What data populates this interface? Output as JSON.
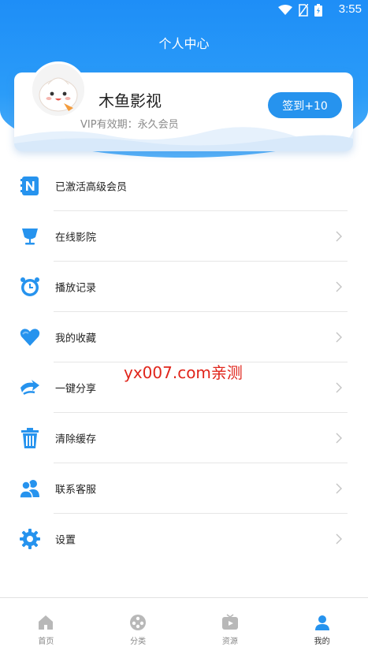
{
  "status_bar": {
    "time": "3:55"
  },
  "header": {
    "title": "个人中心"
  },
  "profile": {
    "name": "木鱼影视",
    "vip": "VIP有效期：永久会员",
    "signin_label": "签到+10"
  },
  "menu": {
    "items": [
      {
        "label": "已激活高级会员",
        "icon": "n-badge-icon",
        "chevron": false
      },
      {
        "label": "在线影院",
        "icon": "cinema-cup-icon",
        "chevron": true
      },
      {
        "label": "播放记录",
        "icon": "alarm-clock-icon",
        "chevron": true
      },
      {
        "label": "我的收藏",
        "icon": "heart-icon",
        "chevron": true
      },
      {
        "label": "一键分享",
        "icon": "share-icon",
        "chevron": true
      },
      {
        "label": "清除缓存",
        "icon": "trash-icon",
        "chevron": true
      },
      {
        "label": "联系客服",
        "icon": "users-icon",
        "chevron": true
      },
      {
        "label": "设置",
        "icon": "gear-icon",
        "chevron": true
      }
    ]
  },
  "watermark": "yx007.com亲测",
  "tabbar": {
    "tabs": [
      {
        "label": "首页",
        "icon": "home-icon"
      },
      {
        "label": "分类",
        "icon": "category-icon"
      },
      {
        "label": "资源",
        "icon": "tv-icon"
      },
      {
        "label": "我的",
        "icon": "profile-icon"
      }
    ],
    "active_index": 3
  },
  "colors": {
    "accent": "#2693ee",
    "header_blue": "#1e8ef7",
    "watermark_red": "#e0251b"
  }
}
